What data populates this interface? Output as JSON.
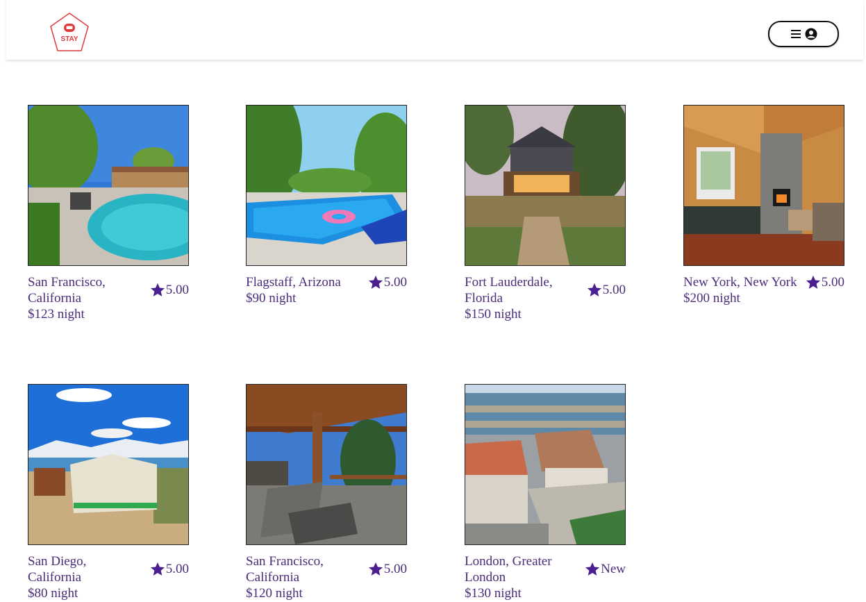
{
  "brand": {
    "logo_text": "STAY",
    "accent": "#e03a3a"
  },
  "colors": {
    "text": "#4a2c7a",
    "star": "#4b1f8f"
  },
  "listings": [
    {
      "location": "San Francisco, California",
      "price": "$123 night",
      "rating": "5.00",
      "photo": "pool-patio"
    },
    {
      "location": "Flagstaff, Arizona",
      "price": "$90 night",
      "rating": "5.00",
      "photo": "pool-float"
    },
    {
      "location": "Fort Lauderdale, Florida",
      "price": "$150 night",
      "rating": "5.00",
      "photo": "cabin-dock"
    },
    {
      "location": "New York, New York",
      "price": "$200 night",
      "rating": "5.00",
      "photo": "log-living-room"
    },
    {
      "location": "San Diego, California",
      "price": "$80 night",
      "rating": "5.00",
      "photo": "glamping-tent"
    },
    {
      "location": "San Francisco, California",
      "price": "$120 night",
      "rating": "5.00",
      "photo": "covered-porch"
    },
    {
      "location": "London, Greater London",
      "price": "$130 night",
      "rating": "New",
      "photo": "waterfront-houses"
    }
  ]
}
